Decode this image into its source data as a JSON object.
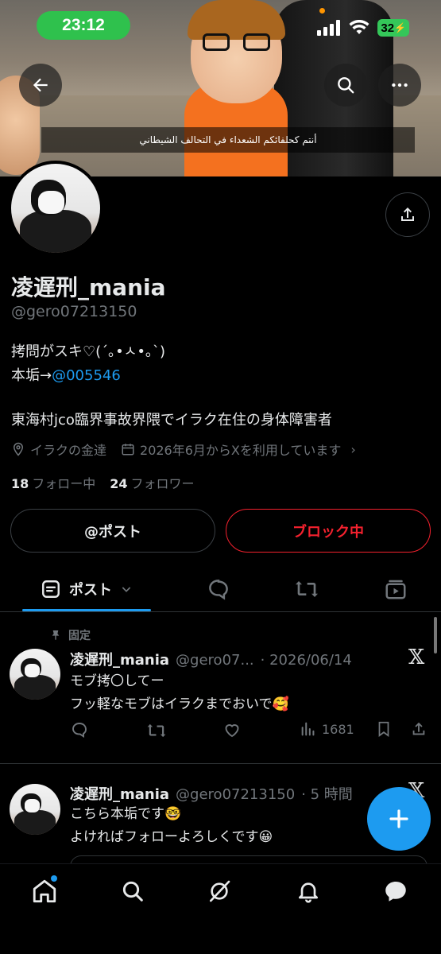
{
  "status_bar": {
    "time": "23:12",
    "battery": "32"
  },
  "banner": {
    "caption": "أنتم كحلفائكم الشعداء في التحالف الشيطاني"
  },
  "profile": {
    "display_name": "凌遅刑_mania",
    "handle": "@gero07213150",
    "bio_line1": "拷問がスキ♡(´｡•ㅅ•｡`)",
    "bio_line2_prefix": "本垢→",
    "bio_line2_link": "@005546",
    "bio_line3": "東海村jco臨界事故界隈でイラク在住の身体障害者",
    "location": "イラクの金達",
    "joined": "2026年6月からXを利用しています",
    "following_count": "18",
    "following_label": "フォロー中",
    "followers_count": "24",
    "followers_label": "フォロワー"
  },
  "buttons": {
    "post": "@ポスト",
    "block": "ブロック中"
  },
  "tabs": {
    "posts": "ポスト"
  },
  "tweets": [
    {
      "pinned_label": "固定",
      "name": "凌遅刑_mania",
      "handle": "@gero07...",
      "time": "· 2026/06/14",
      "line1": "モブ拷〇してー",
      "line2": "フッ軽なモブはイラクまでおいで🥰",
      "views": "1681"
    },
    {
      "name": "凌遅刑_mania",
      "handle": "@gero07213150",
      "time": "· 5 時間",
      "line1": "こちら本垢です🤓",
      "line2": "よければフォローよろしくです😀"
    }
  ],
  "colors": {
    "accent": "#1d9bf0",
    "block_red": "#f4212e",
    "muted": "#71767b",
    "status_green": "#2fc14d"
  },
  "icons": [
    "back-arrow-icon",
    "search-icon",
    "more-icon",
    "share-icon",
    "location-icon",
    "calendar-icon",
    "pin-icon",
    "reply-icon",
    "retweet-icon",
    "like-icon",
    "views-icon",
    "bookmark-icon",
    "share-tweet-icon",
    "x-logo-icon",
    "compose-icon",
    "home-icon",
    "explore-icon",
    "grok-icon",
    "notifications-icon",
    "messages-icon"
  ]
}
